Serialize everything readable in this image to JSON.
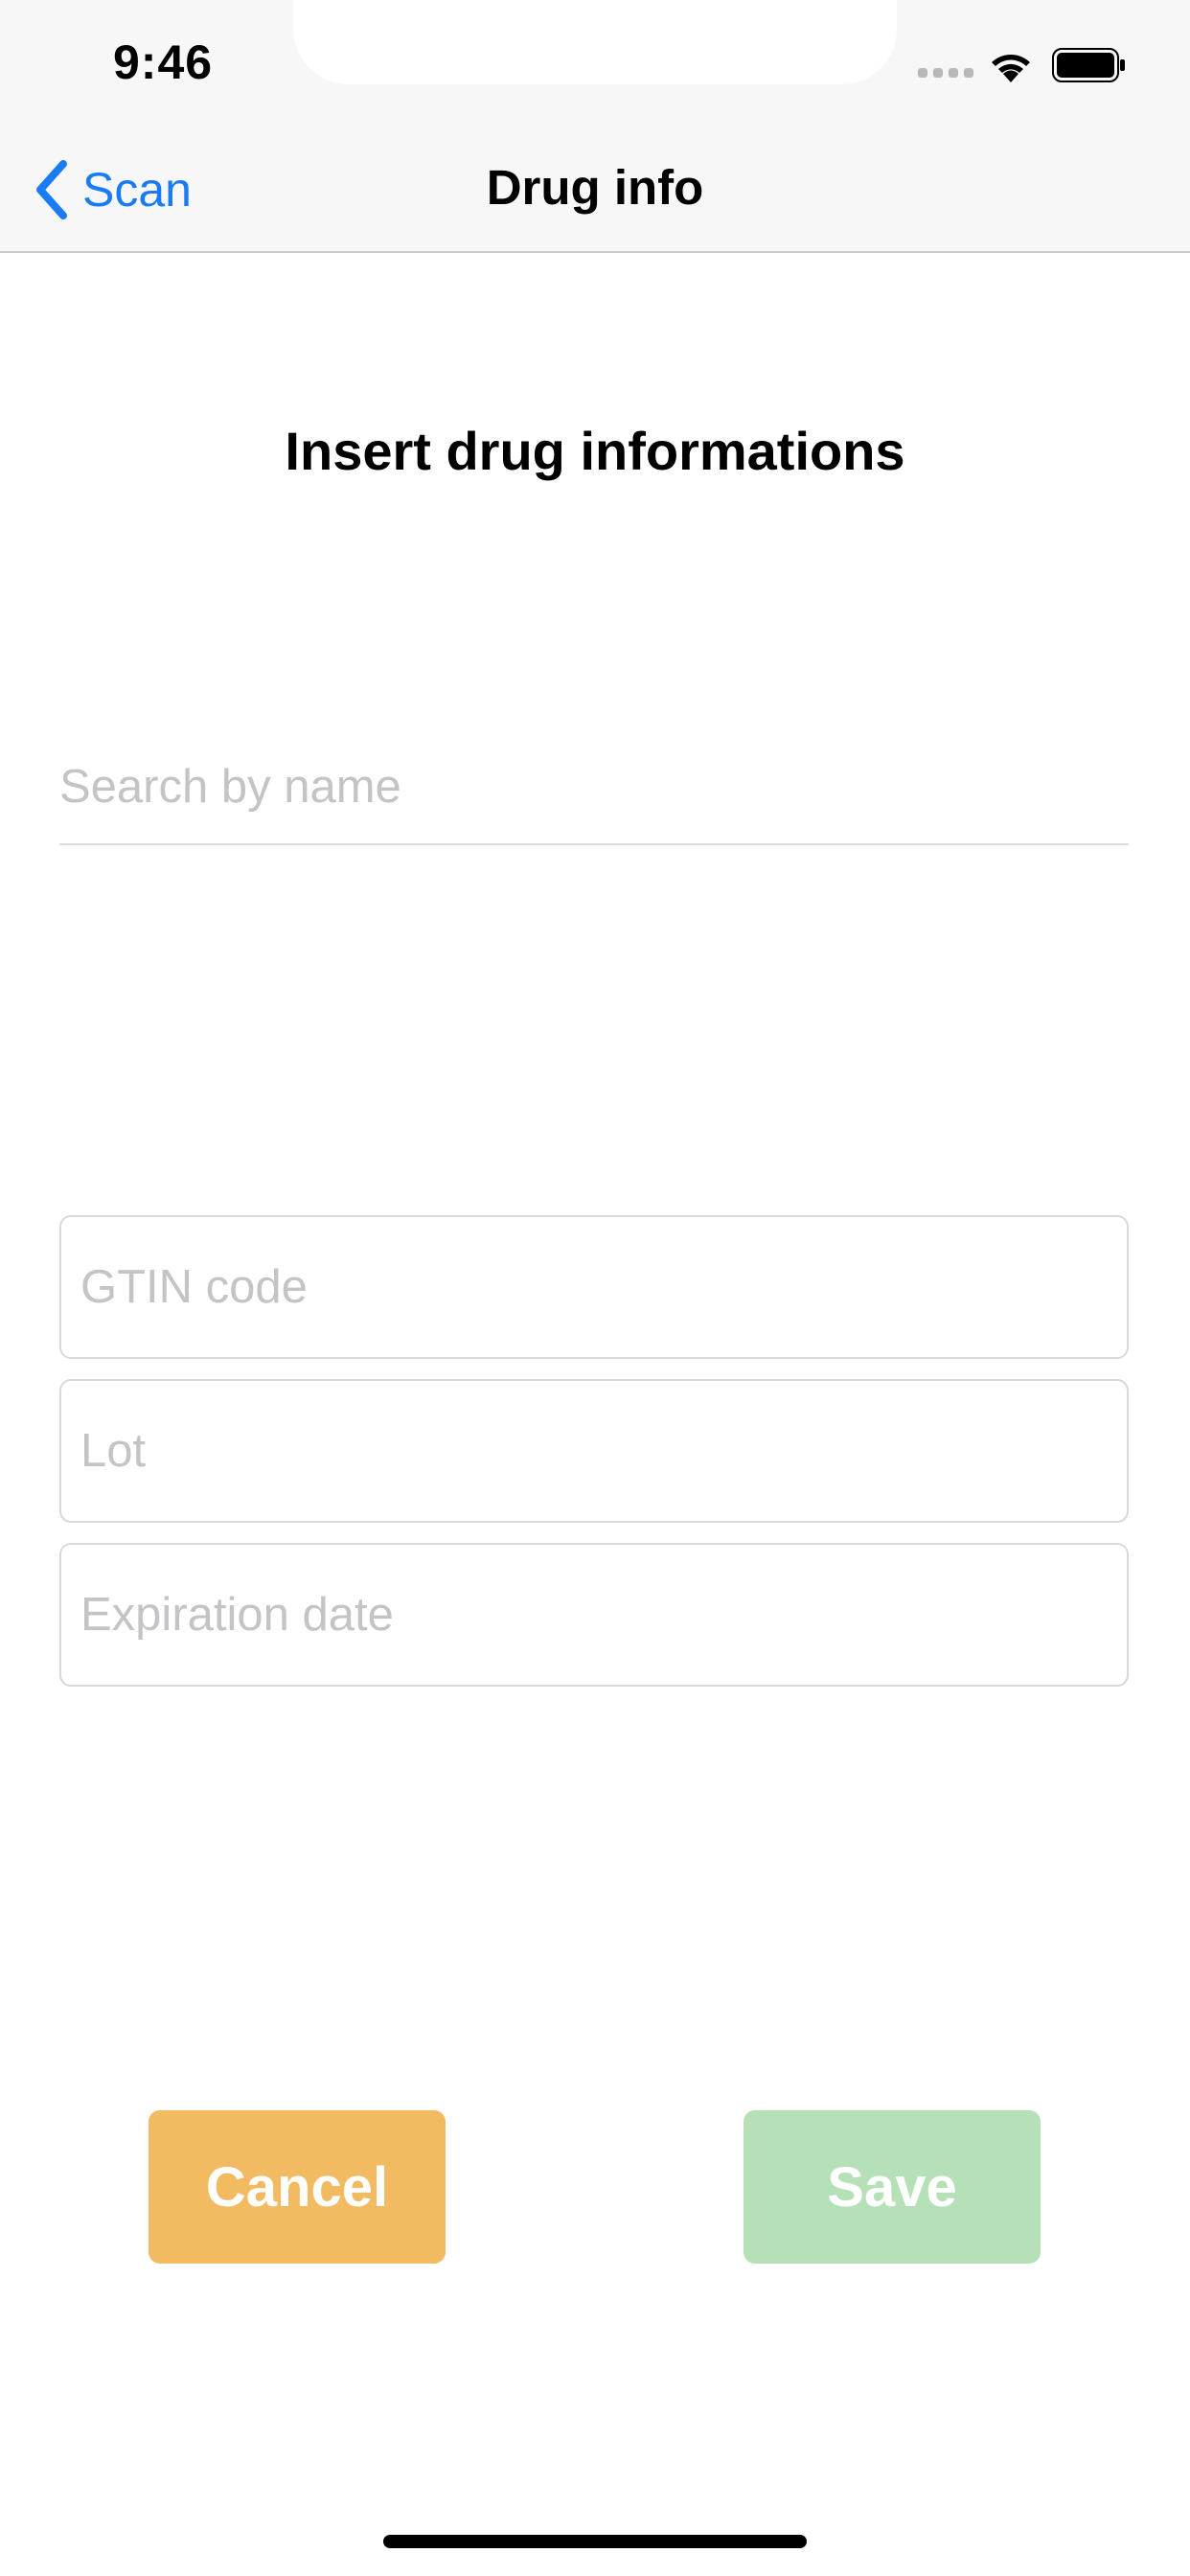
{
  "status_bar": {
    "time": "9:46"
  },
  "nav": {
    "back_label": "Scan",
    "title": "Drug info",
    "accent_color": "#1a7cf5"
  },
  "form": {
    "heading": "Insert drug informations",
    "search_placeholder": "Search by name",
    "search_value": "",
    "gtin_placeholder": "GTIN code",
    "gtin_value": "",
    "lot_placeholder": "Lot",
    "lot_value": "",
    "expiry_placeholder": "Expiration date",
    "expiry_value": ""
  },
  "actions": {
    "cancel_label": "Cancel",
    "cancel_color": "#f2bb62",
    "save_label": "Save",
    "save_color": "#b6e1b8"
  },
  "icons": {
    "back": "chevron-left-icon",
    "signal": "cellular-signal-icon",
    "wifi": "wifi-icon",
    "battery": "battery-icon"
  }
}
